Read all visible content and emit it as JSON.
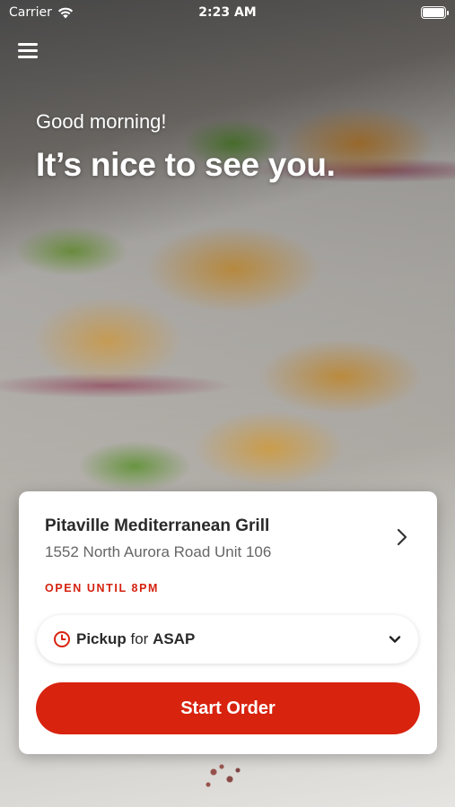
{
  "status_bar": {
    "carrier": "Carrier",
    "time": "2:23 AM"
  },
  "hero": {
    "greeting": "Good morning!",
    "headline": "It’s nice to see you."
  },
  "store": {
    "name": "Pitaville Mediterranean Grill",
    "address": "1552 North Aurora Road Unit 106",
    "open_status": "OPEN UNTIL 8PM"
  },
  "order_type": {
    "mode": "Pickup",
    "connector": "for",
    "time": "ASAP"
  },
  "actions": {
    "start_order": "Start Order"
  },
  "colors": {
    "accent": "#d8230f",
    "text_primary": "#2a2a2a",
    "text_secondary": "#666666"
  },
  "icons": [
    "menu-icon",
    "wifi-icon",
    "battery-icon",
    "chevron-right-icon",
    "clock-icon",
    "chevron-down-icon"
  ]
}
